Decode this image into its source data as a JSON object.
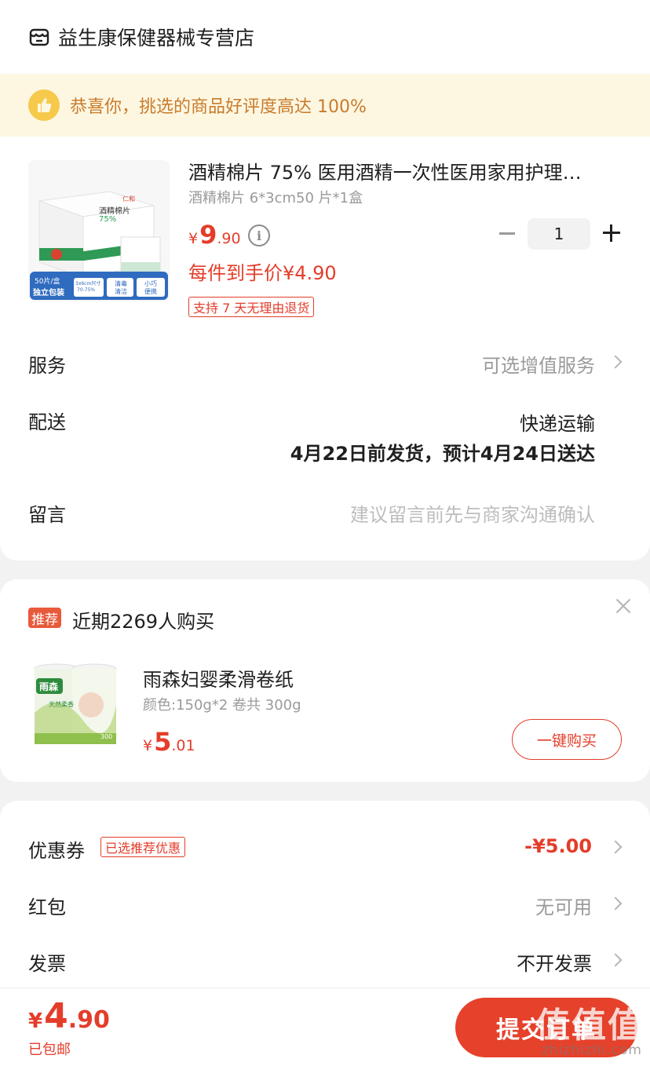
{
  "store": {
    "name": "益生康保健器械专营店",
    "icon": "store-icon"
  },
  "praise": {
    "text": "恭喜你，挑选的商品好评度高达 100%",
    "icon": "thumbs-up-icon"
  },
  "product": {
    "title": "酒精棉片 75% 医用酒精一次性医用家用护理…",
    "spec": "酒精棉片 6*3cm50 片*1盒",
    "price_yen": "¥",
    "price_int": "9",
    "price_dec": ".90",
    "quantity": "1",
    "final_price": "每件到手价¥4.90",
    "return_badge": "支持 7 天无理由退货",
    "image": {
      "box_label": "酒精棉片",
      "box_percent": "75%",
      "brand": "仁和",
      "tag_pack": "50片/盒",
      "tag_pack2": "独立包装",
      "tag_size": "3x6cm尺寸",
      "tag_range": "70-75%",
      "tag_clean": "清毒",
      "tag_clean2": "清洁",
      "tag_small": "小巧",
      "tag_small2": "便携"
    }
  },
  "rows": {
    "service_label": "服务",
    "service_value": "可选增值服务",
    "delivery_label": "配送",
    "delivery_method": "快递运输",
    "delivery_time": "4月22日前发货，预计4月24日送达",
    "message_label": "留言",
    "message_placeholder": "建议留言前先与商家沟通确认"
  },
  "recommend": {
    "badge": "推荐",
    "text": "近期2269人购买",
    "title": "雨森妇婴柔滑卷纸",
    "spec": "颜色:150g*2 卷共 300g",
    "price_yen": "¥",
    "price_int": "5",
    "price_dec": ".01",
    "button": "一键购买",
    "image_brand": "雨森",
    "image_sub": "天然柔香",
    "image_num": "300"
  },
  "discounts": {
    "coupon_label": "优惠券",
    "coupon_tag": "已选推荐优惠",
    "coupon_value": "-¥5.00",
    "redpacket_label": "红包",
    "redpacket_value": "无可用",
    "invoice_label": "发票",
    "invoice_value": "不开发票"
  },
  "footer": {
    "total_yen": "¥",
    "total_int": "4",
    "total_dec": ".90",
    "shipping_note": "已包邮",
    "submit": "提交订单"
  },
  "watermark": {
    "text": "值值值",
    "url": "zhizhizhi.com"
  },
  "colors": {
    "accent": "#e43d2a",
    "praise_bg": "#fdf7e2",
    "praise_text": "#c97b2a"
  }
}
